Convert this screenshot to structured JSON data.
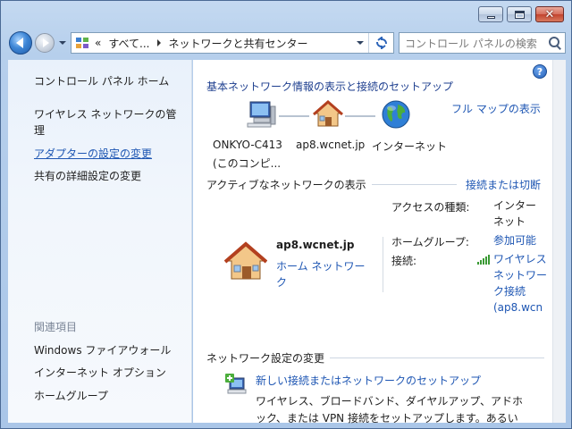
{
  "window": {
    "title_buttons": {
      "minimize": "minimize-icon",
      "maximize": "maximize-icon",
      "close": "close-icon"
    },
    "close_glyph": "✕"
  },
  "navbar": {
    "address": {
      "overflow": "«",
      "crumbs": [
        "すべて...",
        "ネットワークと共有センター"
      ]
    },
    "search": {
      "placeholder": "コントロール パネルの検索"
    }
  },
  "sidebar": {
    "items": [
      {
        "label": "コントロール パネル ホーム",
        "link": false
      },
      {
        "label": "ワイヤレス ネットワークの管",
        "link": false
      },
      {
        "label": "理",
        "link": false
      },
      {
        "label": "アダプターの設定の変更",
        "link": true
      },
      {
        "label": "共有の詳細設定の変更",
        "link": false
      }
    ],
    "related_header": "関連項目",
    "related": [
      "Windows ファイアウォール",
      "インターネット オプション",
      "ホームグループ"
    ]
  },
  "content": {
    "help_glyph": "?",
    "title": "基本ネットワーク情報の表示と接続のセットアップ",
    "full_map_link": "フル マップの表示",
    "map": {
      "computer": {
        "name": "ONKYO-C413",
        "sub": "(このコンピ..."
      },
      "network": {
        "name": "ap8.wcnet.jp"
      },
      "internet": {
        "name": "インターネット"
      }
    },
    "active": {
      "header": "アクティブなネットワークの表示",
      "connect_link": "接続または切断",
      "network_name": "ap8.wcnet.jp",
      "network_type": "ホーム ネットワーク",
      "access_label": "アクセスの種類:",
      "access_value": "インターネット",
      "homegroup_label": "ホームグループ:",
      "homegroup_value": "参加可能",
      "connections_label": "接続:",
      "connections_value": "ワイヤレス ネットワーク接続 (ap8.wcn"
    },
    "change": {
      "header": "ネットワーク設定の変更",
      "task_link": "新しい接続またはネットワークのセットアップ",
      "task_desc": "ワイヤレス、ブロードバンド、ダイヤルアップ、アドホック、または VPN 接続をセットアップします。あるいは、"
    }
  },
  "colors": {
    "link": "#1e56b3",
    "title": "#1e3f8f"
  }
}
